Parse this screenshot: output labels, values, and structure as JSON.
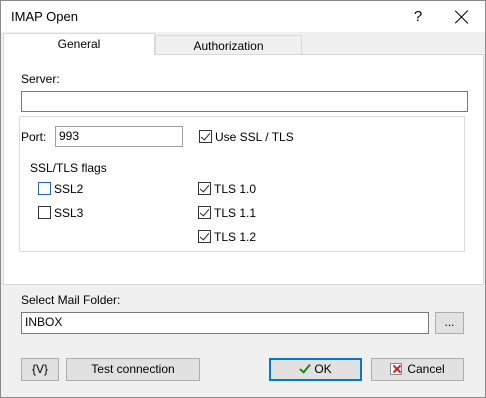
{
  "window": {
    "title": "IMAP Open"
  },
  "titlebar": {
    "help_label": "?"
  },
  "tabs": [
    {
      "label": "General",
      "selected": true
    },
    {
      "label": "Authorization",
      "selected": false
    }
  ],
  "general": {
    "server_label": "Server:",
    "server_value": "",
    "port_label": "Port:",
    "port_value": "993",
    "use_ssl_label": "Use SSL / TLS",
    "use_ssl_checked": true,
    "ssl_flags": {
      "legend": "SSL/TLS flags",
      "items": [
        {
          "label": "SSL2",
          "checked": false
        },
        {
          "label": "SSL3",
          "checked": false
        },
        {
          "label": "TLS 1.0",
          "checked": true
        },
        {
          "label": "TLS 1.1",
          "checked": true
        },
        {
          "label": "TLS 1.2",
          "checked": true
        }
      ]
    }
  },
  "mail_folder": {
    "label": "Select Mail Folder:",
    "value": "INBOX",
    "browse_label": "..."
  },
  "footer": {
    "variables_label": "{V}",
    "test_label": "Test connection",
    "ok_label": "OK",
    "cancel_label": "Cancel"
  },
  "colors": {
    "accent": "#0078d7",
    "ok_check": "#1b8a1b",
    "cancel_x": "#d0201e"
  }
}
